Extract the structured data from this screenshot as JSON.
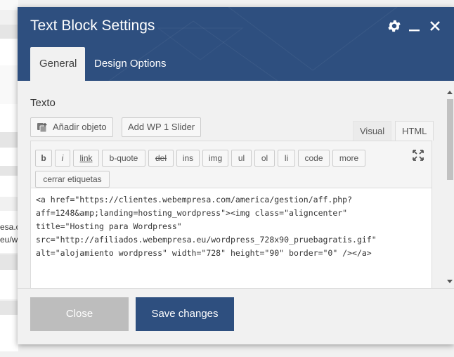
{
  "background": {
    "fragments": [
      "esa.c",
      "eu/wo"
    ]
  },
  "modal": {
    "title": "Text Block Settings",
    "tabs": [
      {
        "label": "General",
        "active": true
      },
      {
        "label": "Design Options",
        "active": false
      }
    ],
    "field_label": "Texto",
    "media_buttons": {
      "add_object": "Añadir objeto",
      "add_slider": "Add WP 1 Slider"
    },
    "editor_modes": {
      "visual": "Visual",
      "html": "HTML"
    },
    "quicktags": {
      "b": "b",
      "i": "i",
      "link": "link",
      "bquote": "b-quote",
      "del": "del",
      "ins": "ins",
      "img": "img",
      "ul": "ul",
      "ol": "ol",
      "li": "li",
      "code": "code",
      "more": "more",
      "close_tags": "cerrar etiquetas"
    },
    "code_lines": [
      "<a href=\"https://clientes.webempresa.com/america/gestion/aff.php?",
      "aff=1248&amp;landing=hosting_wordpress\"><img class=\"aligncenter\"",
      "title=\"Hosting para Wordpress\"",
      "src=\"http://afiliados.webempresa.eu/wordpress_728x90_pruebagratis.gif\"",
      "alt=\"alojamiento wordpress\" width=\"728\" height=\"90\" border=\"0\" /></a>"
    ],
    "footer": {
      "close_label": "Close",
      "save_label": "Save changes"
    }
  },
  "colors": {
    "header_bg": "#2e4f7f",
    "save_bg": "#2e4f7f",
    "close_bg": "#bdbdbd"
  },
  "icons": [
    "gear-icon",
    "minimize-icon",
    "close-icon",
    "media-add-icon",
    "fullscreen-icon"
  ]
}
